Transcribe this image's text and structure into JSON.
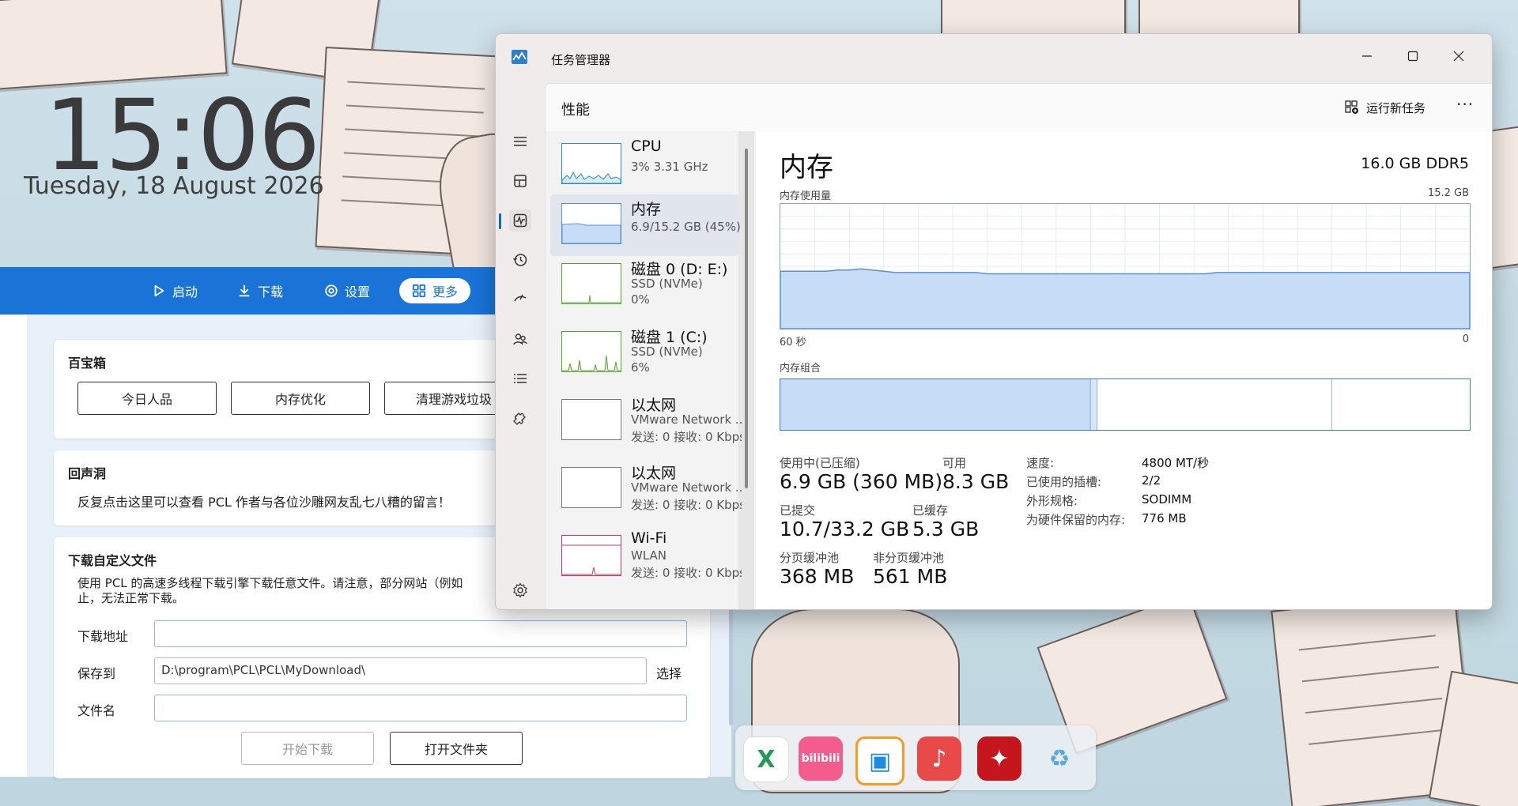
{
  "desktop": {
    "time": "15:06",
    "date": "Tuesday, 18 August 2026"
  },
  "pcl": {
    "nav": [
      {
        "label": "启动",
        "icon": "play-icon"
      },
      {
        "label": "下载",
        "icon": "download-icon"
      },
      {
        "label": "设置",
        "icon": "settings-icon"
      },
      {
        "label": "更多",
        "icon": "grid-icon",
        "active": true
      }
    ],
    "toolbox": {
      "title": "百宝箱",
      "buttons": [
        "今日人品",
        "内存优化",
        "清理游戏垃圾"
      ]
    },
    "echo": {
      "title": "回声洞",
      "text": "反复点击这里可以查看 PCL 作者与各位沙雕网友乱七八糟的留言！"
    },
    "download": {
      "title": "下载自定义文件",
      "desc_line1": "使用 PCL 的高速多线程下载引擎下载任意文件。请注意，部分网站（例如",
      "desc_line2": "止，无法正常下载。",
      "url_label": "下载地址",
      "url_value": "",
      "save_label": "保存到",
      "save_value": "D:\\program\\PCL\\PCL\\MyDownload\\",
      "choose_label": "选择",
      "filename_label": "文件名",
      "filename_value": "",
      "start_button": "开始下载",
      "open_folder_button": "打开文件夹"
    }
  },
  "dock": {
    "icons": [
      {
        "name": "excel-icon",
        "glyph": "X",
        "color": "#1f9d55"
      },
      {
        "name": "bilibili-icon",
        "glyph": "bilibili",
        "color": "#f25d8e"
      },
      {
        "name": "vmware-icon",
        "glyph": "▣",
        "color": "#1d8ce0"
      },
      {
        "name": "netease-music-icon",
        "glyph": "♪",
        "color": "#e84a4a"
      },
      {
        "name": "chaoxing-icon",
        "glyph": "✦",
        "color": "#c4161c"
      },
      {
        "name": "recycle-bin-icon",
        "glyph": "♻",
        "color": "#5aa9d8"
      }
    ]
  },
  "taskmanager": {
    "title": "任务管理器",
    "section": "性能",
    "run_new_task": "运行新任务",
    "more": "···",
    "devices": [
      {
        "name": "CPU",
        "sub1": "3% 3.31 GHz",
        "sub2": "",
        "sub3": ""
      },
      {
        "name": "内存",
        "sub1": "6.9/15.2 GB (45%)",
        "sub2": "",
        "sub3": ""
      },
      {
        "name": "磁盘 0 (D: E:)",
        "sub1": "SSD (NVMe)",
        "sub2": "0%",
        "sub3": ""
      },
      {
        "name": "磁盘 1 (C:)",
        "sub1": "SSD (NVMe)",
        "sub2": "6%",
        "sub3": ""
      },
      {
        "name": "以太网",
        "sub1": "VMware Network ...",
        "sub2": "发送: 0 接收: 0 Kbps",
        "sub3": ""
      },
      {
        "name": "以太网",
        "sub1": "VMware Network ...",
        "sub2": "发送: 0 接收: 0 Kbps",
        "sub3": ""
      },
      {
        "name": "Wi-Fi",
        "sub1": "WLAN",
        "sub2": "发送: 0 接收: 0 Kbps",
        "sub3": ""
      }
    ],
    "memory": {
      "title": "内存",
      "spec": "16.0 GB DDR5",
      "usage_label": "内存使用量",
      "usage_max": "15.2 GB",
      "x_start": "60 秒",
      "x_end": "0",
      "composition_label": "内存组合",
      "composition": {
        "in_use": 0.45,
        "modified": 0.01,
        "standby": 0.34,
        "free": 0.2
      },
      "stats": {
        "in_use_label": "使用中(已压缩)",
        "in_use_value": "6.9 GB (360 MB)",
        "available_label": "可用",
        "available_value": "8.3 GB",
        "committed_label": "已提交",
        "committed_value": "10.7/33.2 GB",
        "cached_label": "已缓存",
        "cached_value": "5.3 GB",
        "paged_label": "分页缓冲池",
        "paged_value": "368 MB",
        "nonpaged_label": "非分页缓冲池",
        "nonpaged_value": "561 MB"
      },
      "props": {
        "speed_label": "速度:",
        "speed_value": "4800 MT/秒",
        "slots_label": "已使用的插槽:",
        "slots_value": "2/2",
        "form_label": "外形规格:",
        "form_value": "SODIMM",
        "reserved_label": "为硬件保留的内存:",
        "reserved_value": "776 MB"
      },
      "history_percent": [
        46,
        46,
        46,
        46,
        46,
        47,
        47,
        48,
        47,
        46,
        45,
        45,
        45,
        45,
        45,
        45,
        45,
        45,
        44,
        44,
        44,
        44,
        44,
        44,
        44,
        44,
        44,
        44,
        44,
        44,
        44,
        44,
        44,
        44,
        44,
        44,
        44,
        44,
        45,
        45,
        45,
        45,
        45,
        45,
        45,
        45,
        45,
        45,
        45,
        45,
        45,
        45,
        45,
        45,
        45,
        45,
        45,
        45,
        45,
        45,
        45
      ]
    },
    "colors": {
      "accent": "#0f6cbd",
      "memory_fill": "#c7dcf6",
      "memory_line": "#5b8fd1"
    }
  }
}
